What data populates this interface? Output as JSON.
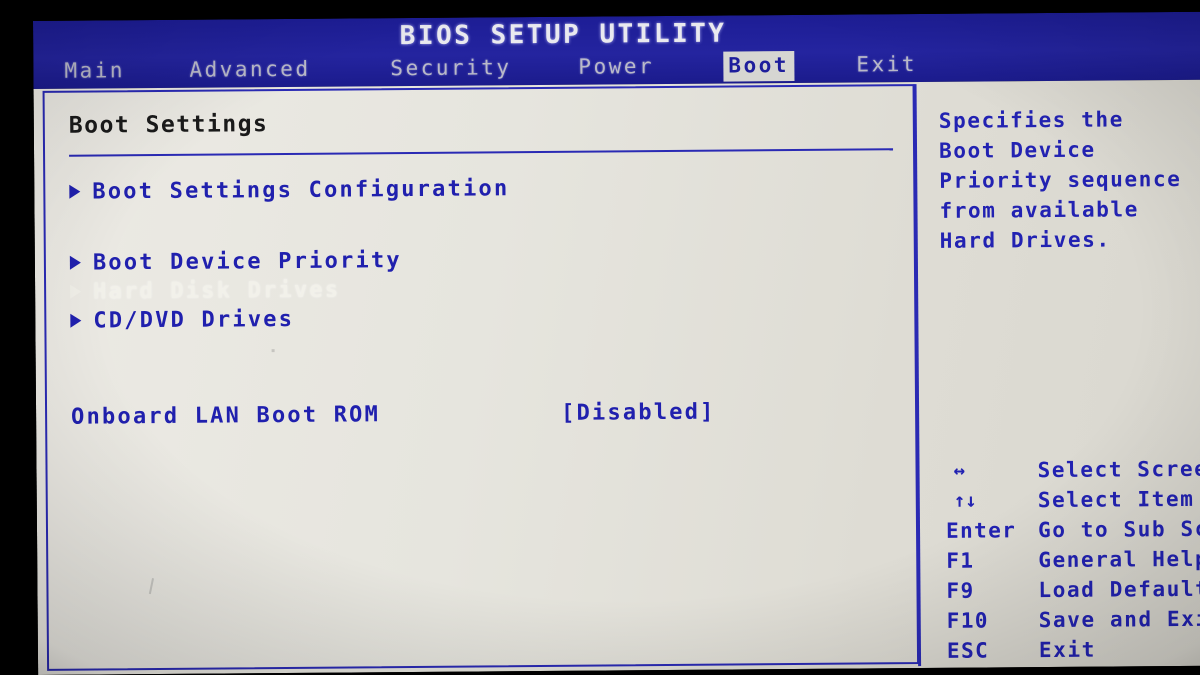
{
  "header": {
    "title": "BIOS SETUP UTILITY",
    "tabs": [
      {
        "label": "Main",
        "active": false
      },
      {
        "label": "Advanced",
        "active": false
      },
      {
        "label": "Security",
        "active": false
      },
      {
        "label": "Power",
        "active": false
      },
      {
        "label": "Boot",
        "active": true
      },
      {
        "label": "Exit",
        "active": false
      }
    ]
  },
  "main": {
    "section_title": "Boot Settings",
    "submenu_items": [
      {
        "label": "Boot Settings Configuration",
        "selected": false
      },
      {
        "label": "Boot Device Priority",
        "selected": false
      },
      {
        "label": "Hard Disk Drives",
        "selected": true
      },
      {
        "label": "CD/DVD Drives",
        "selected": false
      }
    ],
    "settings": [
      {
        "name": "Onboard LAN Boot ROM",
        "value": "[Disabled]"
      }
    ]
  },
  "help": {
    "lines": [
      "Specifies the",
      "Boot Device",
      "Priority sequence",
      "from available",
      "Hard Drives."
    ]
  },
  "key_legend": [
    {
      "key": "↔",
      "desc": "Select Screen",
      "symbol": true
    },
    {
      "key": "↑↓",
      "desc": "Select Item",
      "symbol": true
    },
    {
      "key": "Enter",
      "desc": "Go to Sub Screen",
      "symbol": false
    },
    {
      "key": "F1",
      "desc": "General Help",
      "symbol": false
    },
    {
      "key": "F9",
      "desc": "Load Defaults",
      "symbol": false
    },
    {
      "key": "F10",
      "desc": "Save and Exit",
      "symbol": false
    },
    {
      "key": "ESC",
      "desc": "Exit",
      "symbol": false
    }
  ],
  "colors": {
    "header_blue": "#20219e",
    "body_bg": "#e6e6e1",
    "text_blue": "#2020ae",
    "selected_text": "#f2f1ea",
    "title_black": "#1a1a1a"
  }
}
